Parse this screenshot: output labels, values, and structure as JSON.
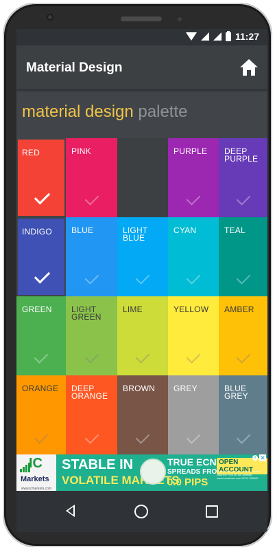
{
  "status": {
    "time": "11:27"
  },
  "appbar": {
    "title": "Material Design",
    "home_icon": "home-icon"
  },
  "subtitle": {
    "part1": "material design",
    "part2": "palette"
  },
  "palette": {
    "rows": [
      [
        {
          "label": "RED",
          "bg": "#f44336",
          "fg": "#ffffff",
          "selected": true
        },
        {
          "label": "PINK",
          "bg": "#e91e63",
          "fg": "#ffffff",
          "selected": false
        },
        {
          "label": "",
          "bg": "#3c4043",
          "fg": "#ffffff",
          "selected": false
        },
        {
          "label": "PURPLE",
          "bg": "#9c27b0",
          "fg": "#ffffff",
          "selected": false
        },
        {
          "label": "DEEP PURPLE",
          "bg": "#673ab7",
          "fg": "#ffffff",
          "selected": false
        }
      ],
      [
        {
          "label": "INDIGO",
          "bg": "#3f51b5",
          "fg": "#ffffff",
          "selected": true
        },
        {
          "label": "BLUE",
          "bg": "#2196f3",
          "fg": "#ffffff",
          "selected": false
        },
        {
          "label": "LIGHT BLUE",
          "bg": "#03a9f4",
          "fg": "#ffffff",
          "selected": false
        },
        {
          "label": "CYAN",
          "bg": "#00bcd4",
          "fg": "#ffffff",
          "selected": false
        },
        {
          "label": "TEAL",
          "bg": "#009688",
          "fg": "#ffffff",
          "selected": false
        }
      ],
      [
        {
          "label": "GREEN",
          "bg": "#4caf50",
          "fg": "#ffffff",
          "selected": false
        },
        {
          "label": "LIGHT GREEN",
          "bg": "#8bc34a",
          "fg": "#3a3a3a",
          "selected": false
        },
        {
          "label": "LIME",
          "bg": "#cddc39",
          "fg": "#3a3a3a",
          "selected": false
        },
        {
          "label": "YELLOW",
          "bg": "#ffeb3b",
          "fg": "#3a3a3a",
          "selected": false
        },
        {
          "label": "AMBER",
          "bg": "#ffc107",
          "fg": "#3a3a3a",
          "selected": false
        }
      ],
      [
        {
          "label": "ORANGE",
          "bg": "#ff9800",
          "fg": "#3a3a3a",
          "selected": false
        },
        {
          "label": "DEEP ORANGE",
          "bg": "#ff5722",
          "fg": "#ffffff",
          "selected": false
        },
        {
          "label": "BROWN",
          "bg": "#795548",
          "fg": "#ffffff",
          "selected": false
        },
        {
          "label": "GREY",
          "bg": "#9e9e9e",
          "fg": "#ffffff",
          "selected": false
        },
        {
          "label": "BLUE GREY",
          "bg": "#607d8b",
          "fg": "#ffffff",
          "selected": false
        }
      ]
    ]
  },
  "ad": {
    "logo_ic": "IC",
    "logo_text": "Markets",
    "logo_url": "www.icmarkets.com",
    "line1": "STABLE IN",
    "line2": "VOLATILE MARKETS",
    "true_ecn": "TRUE ECN",
    "spreads": "SPREADS FROM",
    "pips": "0.0 PIPS",
    "cta": "OPEN ACCOUNT",
    "fine": "Forex trading involves risks. Please read the PDS on our website. www.icmarkets.com AFSL 335692"
  }
}
